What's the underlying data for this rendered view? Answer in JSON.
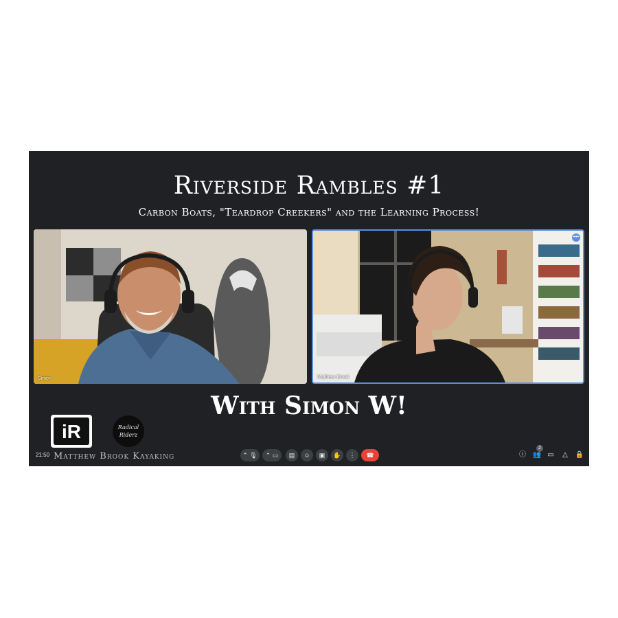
{
  "title": "Riverside Rambles #1",
  "subtitle": "Carbon Boats, \"Teardrop Creekers\" and the Learning Process!",
  "with_caption": "With Simon W!",
  "participants": [
    {
      "name": "Simon"
    },
    {
      "name": "Matthew Brook"
    }
  ],
  "meeting": {
    "time": "21:50",
    "brand_text": "Matthew Brook Kayaking",
    "participant_count": "2"
  },
  "logos": {
    "left": "iR",
    "right": "Radical Riderz"
  },
  "controls": {
    "more_label": "•••"
  },
  "colors": {
    "background": "#202124",
    "accent": "#5b8de6",
    "end_call": "#ea4335",
    "control_bg": "#3c4043"
  },
  "icons": [
    "mic-icon",
    "camera-icon",
    "captions-icon",
    "emoji-icon",
    "present-icon",
    "raise-hand-icon",
    "more-vert-icon",
    "end-call-icon",
    "info-icon",
    "people-icon",
    "chat-icon",
    "activities-icon",
    "lock-icon"
  ]
}
